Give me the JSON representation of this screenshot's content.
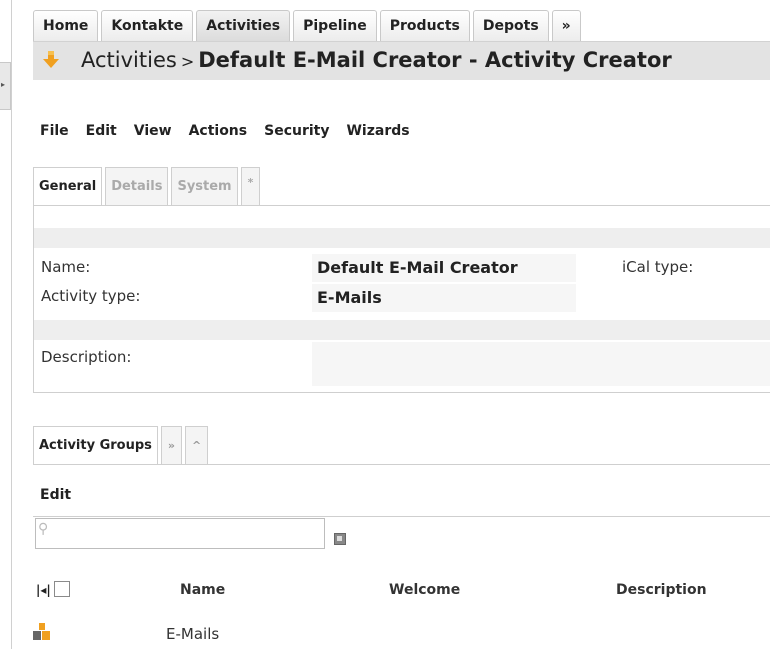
{
  "nav": {
    "tabs": [
      "Home",
      "Kontakte",
      "Activities",
      "Pipeline",
      "Products",
      "Depots",
      "»"
    ],
    "active_index": 2
  },
  "header": {
    "breadcrumb": "Activities",
    "separator": ">",
    "object_title": "Default E-Mail Creator - Activity Creator"
  },
  "menu": [
    "File",
    "Edit",
    "View",
    "Actions",
    "Security",
    "Wizards"
  ],
  "subtabs": [
    "General",
    "Details",
    "System",
    "*"
  ],
  "fields": {
    "name_label": "Name:",
    "name_value": "Default E-Mail Creator",
    "ical_label": "iCal type:",
    "ical_value": "",
    "activity_type_label": "Activity type:",
    "activity_type_value": "E-Mails",
    "description_label": "Description:",
    "description_value": ""
  },
  "groups": {
    "tabs": [
      "Activity Groups",
      "»",
      "^"
    ],
    "edit_label": "Edit",
    "search_placeholder": "",
    "columns": [
      "Name",
      "Welcome",
      "Description"
    ],
    "rows": [
      {
        "name": "E-Mails",
        "welcome": "",
        "description": ""
      }
    ]
  },
  "colors": {
    "accent_orange": "#f0a020",
    "header_gray": "#e3e3e3"
  }
}
